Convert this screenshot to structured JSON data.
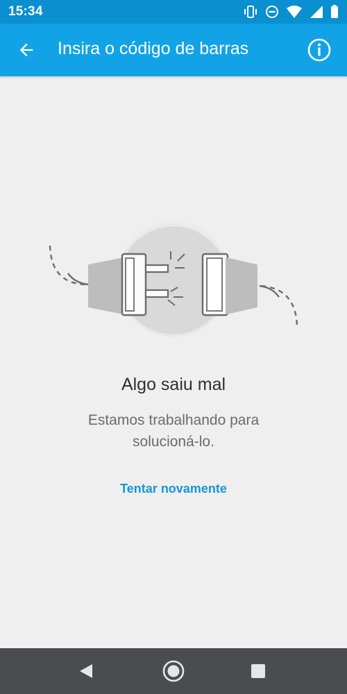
{
  "status_bar": {
    "time": "15:34",
    "icons": [
      "vibrate-icon",
      "do-not-disturb-icon",
      "wifi-icon",
      "signal-icon",
      "battery-icon"
    ]
  },
  "app_bar": {
    "title": "Insira o código de barras",
    "back_icon": "arrow-back-icon",
    "info_icon": "info-icon",
    "background": "#12a3e6"
  },
  "error": {
    "illustration": "disconnected-plug-icon",
    "title": "Algo saiu mal",
    "message": "Estamos trabalhando para solucioná-lo.",
    "retry_label": "Tentar novamente",
    "link_color": "#1596d8"
  },
  "nav_bar": {
    "buttons": [
      "back-triangle-icon",
      "home-circle-icon",
      "recents-square-icon"
    ]
  }
}
